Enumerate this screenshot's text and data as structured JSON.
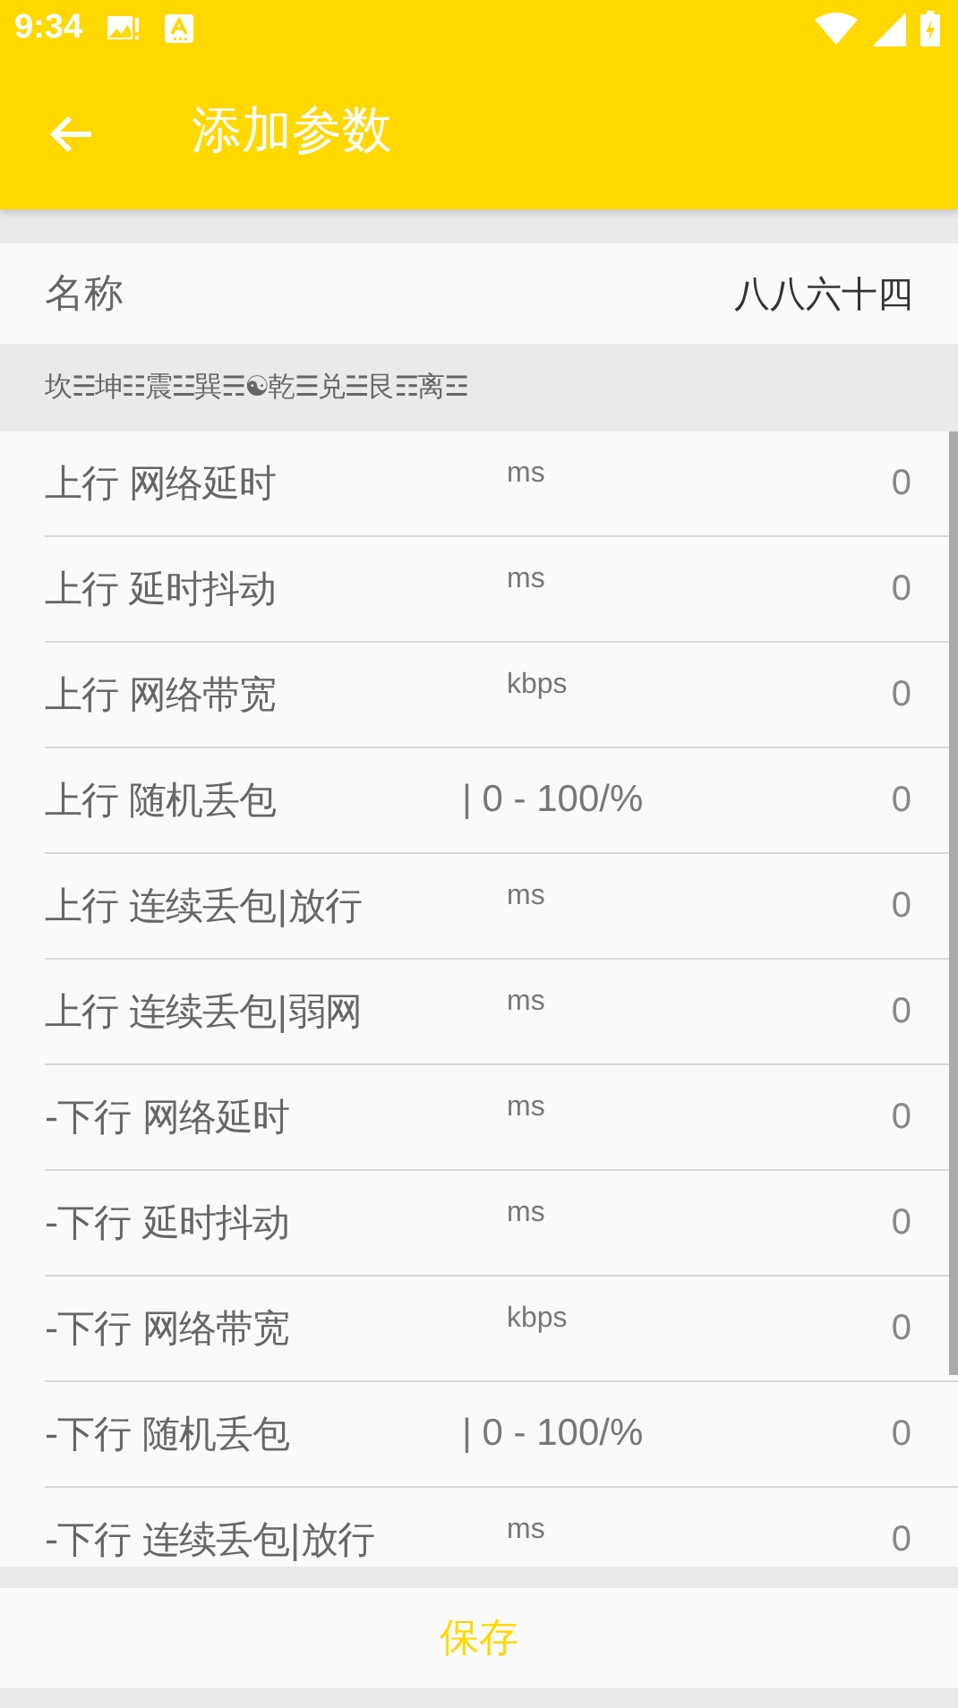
{
  "status_bar": {
    "time": "9:34"
  },
  "toolbar": {
    "title": "添加参数"
  },
  "name_field": {
    "label": "名称",
    "value": "八八六十四"
  },
  "hint": "坎☵坤☷震☳巽☴☯乾☰兑☱艮☶离☲",
  "params": [
    {
      "label": "上行 网络延时",
      "unit": "ms",
      "value": "0",
      "kind": "unit"
    },
    {
      "label": "上行 延时抖动",
      "unit": "ms",
      "value": "0",
      "kind": "unit"
    },
    {
      "label": "上行 网络带宽",
      "unit": "kbps",
      "value": "0",
      "kind": "unit"
    },
    {
      "label": "上行 随机丢包",
      "unit": "| 0 - 100/%",
      "value": "0",
      "kind": "range"
    },
    {
      "label": "上行 连续丢包|放行",
      "unit": "ms",
      "value": "0",
      "kind": "unit"
    },
    {
      "label": "上行 连续丢包|弱网",
      "unit": "ms",
      "value": "0",
      "kind": "unit"
    },
    {
      "label": "-下行 网络延时",
      "unit": "ms",
      "value": "0",
      "kind": "unit"
    },
    {
      "label": "-下行 延时抖动",
      "unit": "ms",
      "value": "0",
      "kind": "unit"
    },
    {
      "label": "-下行 网络带宽",
      "unit": "kbps",
      "value": "0",
      "kind": "unit"
    },
    {
      "label": "-下行 随机丢包",
      "unit": "| 0 - 100/%",
      "value": "0",
      "kind": "range"
    },
    {
      "label": "-下行 连续丢包|放行",
      "unit": "ms",
      "value": "0",
      "kind": "unit"
    }
  ],
  "save_button": "保存"
}
